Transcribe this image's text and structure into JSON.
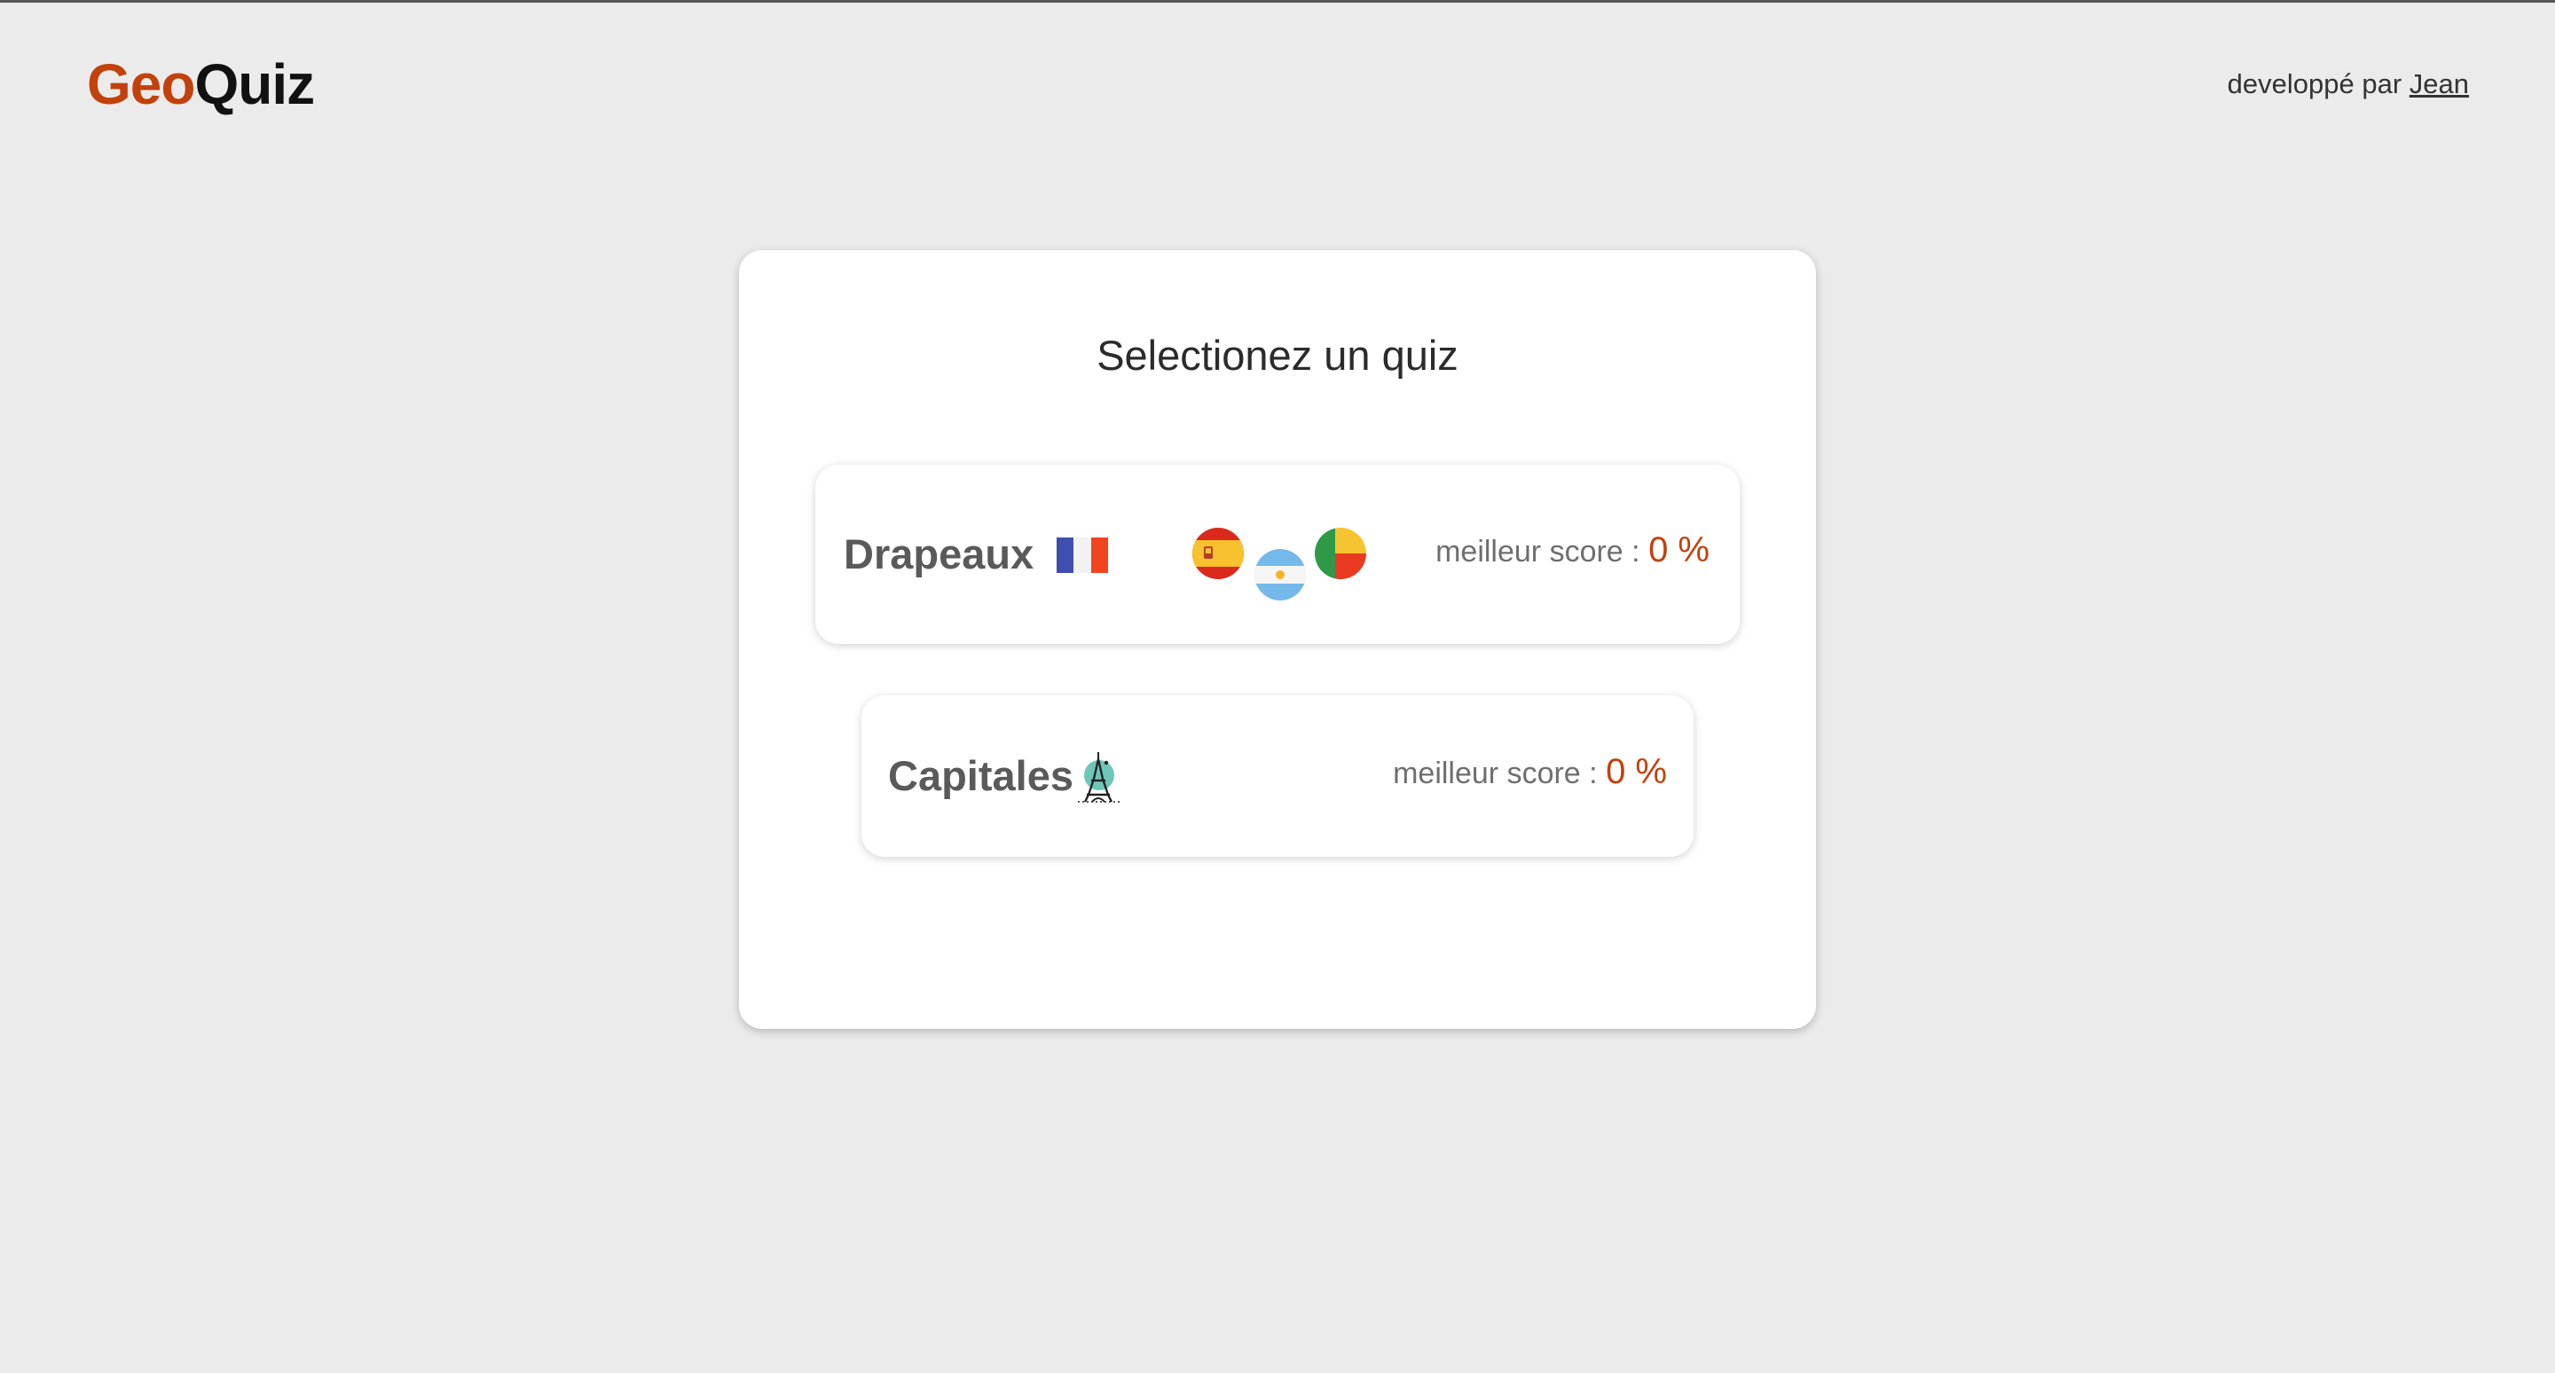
{
  "header": {
    "logo_part1": "Geo",
    "logo_part2": "Quiz",
    "credit_text": "developpé par ",
    "credit_link": "Jean"
  },
  "main": {
    "title": "Selectionez un quiz",
    "quizzes": [
      {
        "name": "Drapeaux",
        "score_label": "meilleur score : ",
        "score_value": "0 %",
        "icons": [
          "france-flag-icon",
          "spain-flag-icon",
          "argentina-flag-icon",
          "benin-flag-icon"
        ]
      },
      {
        "name": "Capitales",
        "score_label": "meilleur score : ",
        "score_value": "0 %",
        "icons": [
          "eiffel-tower-icon"
        ]
      }
    ]
  },
  "colors": {
    "accent": "#c2410c",
    "background": "#ebebeb",
    "card": "#ffffff"
  }
}
